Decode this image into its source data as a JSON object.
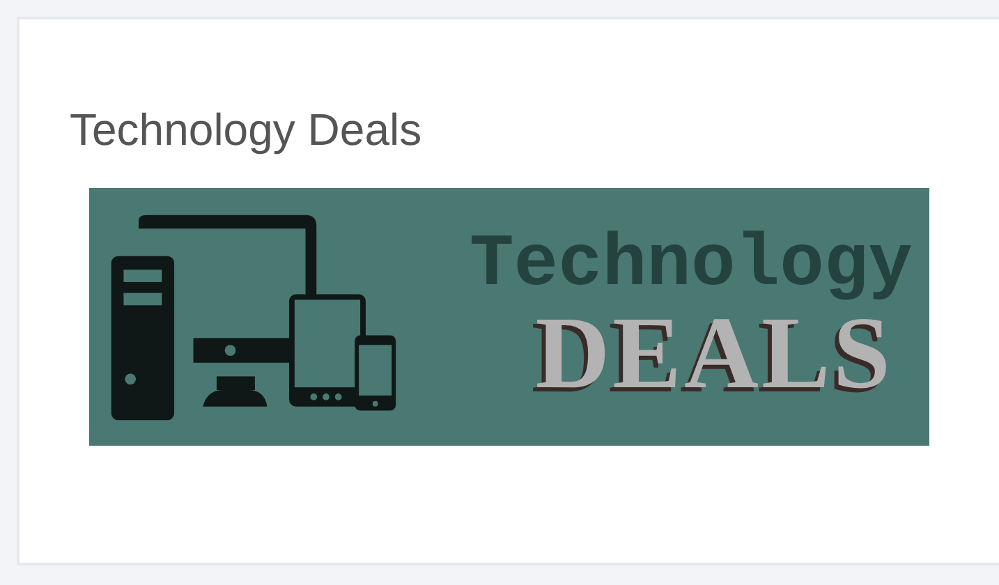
{
  "card": {
    "title": "Technology Deals",
    "banner": {
      "line_1": "Technology",
      "line_2": "DEALS"
    }
  }
}
